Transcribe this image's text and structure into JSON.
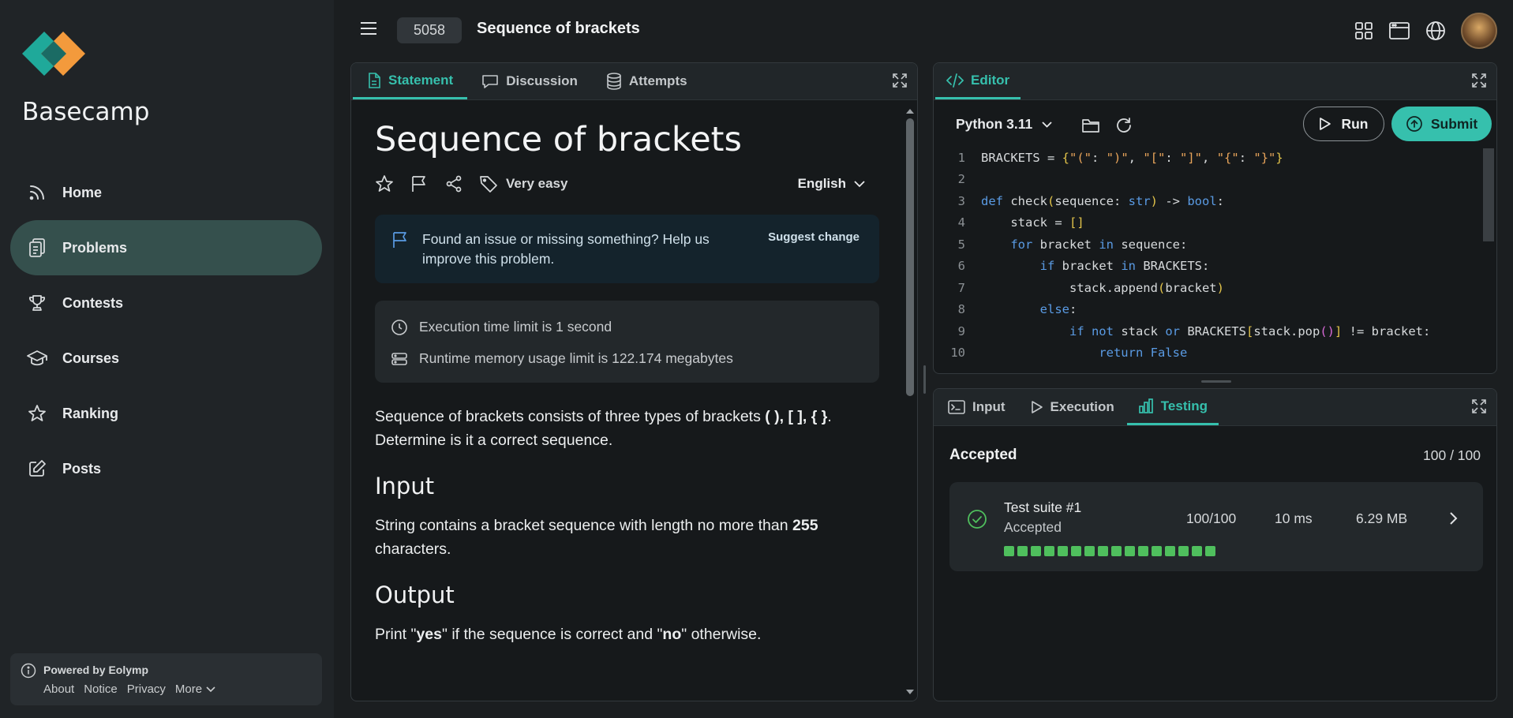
{
  "app": {
    "brand": "Basecamp"
  },
  "sidebar": {
    "items": [
      {
        "label": "Home",
        "icon": "rss-icon",
        "active": false
      },
      {
        "label": "Problems",
        "icon": "clipboard-icon",
        "active": true
      },
      {
        "label": "Contests",
        "icon": "trophy-icon",
        "active": false
      },
      {
        "label": "Courses",
        "icon": "graduation-cap-icon",
        "active": false
      },
      {
        "label": "Ranking",
        "icon": "star-icon",
        "active": false
      },
      {
        "label": "Posts",
        "icon": "edit-icon",
        "active": false
      }
    ],
    "powered": "Powered by Eolymp",
    "links": [
      "About",
      "Notice",
      "Privacy",
      "More"
    ]
  },
  "header": {
    "problem_id": "5058",
    "title": "Sequence of brackets"
  },
  "statement": {
    "tabs": [
      "Statement",
      "Discussion",
      "Attempts"
    ],
    "title": "Sequence of brackets",
    "difficulty": "Very easy",
    "language": "English",
    "notice": "Found an issue or missing something? Help us improve this problem.",
    "suggest": "Suggest change",
    "time_limit": "Execution time limit is 1 second",
    "memory_limit": "Runtime memory usage limit is 122.174 megabytes",
    "desc_a": "Sequence of brackets consists of three types of brackets ",
    "desc_b": "( ), [ ], { }",
    "desc_c": ". Determine is it a correct sequence.",
    "input_heading": "Input",
    "input_a": "String contains a bracket sequence with length no more than ",
    "input_b": "255",
    "input_c": " characters.",
    "output_heading": "Output",
    "output_a": "Print \"",
    "output_b": "yes",
    "output_c": "\" if the sequence is correct and \"",
    "output_d": "no",
    "output_e": "\" otherwise."
  },
  "editor": {
    "tab": "Editor",
    "language": "Python 3.11",
    "run": "Run",
    "submit": "Submit",
    "line_numbers": [
      "1",
      "2",
      "3",
      "4",
      "5",
      "6",
      "7",
      "8",
      "9",
      "10"
    ],
    "code_lines": [
      "BRACKETS = {\"(\": \")\", \"[\": \"]\", \"{\": \"}\"}",
      "",
      "def check(sequence: str) -> bool:",
      "    stack = []",
      "    for bracket in sequence:",
      "        if bracket in BRACKETS:",
      "            stack.append(bracket)",
      "        else:",
      "            if not stack or BRACKETS[stack.pop()] != bracket:",
      "                return False"
    ]
  },
  "results": {
    "tabs": [
      "Input",
      "Execution",
      "Testing"
    ],
    "status": "Accepted",
    "score": "100 / 100",
    "suite_name": "Test suite #1",
    "suite_status": "Accepted",
    "suite_points": "100/100",
    "suite_time": "10 ms",
    "suite_memory": "6.29 MB",
    "tests_passed": 16
  },
  "colors": {
    "accent": "#36c0ad",
    "active_nav": "#35504d",
    "pass": "#4fbf5d"
  }
}
